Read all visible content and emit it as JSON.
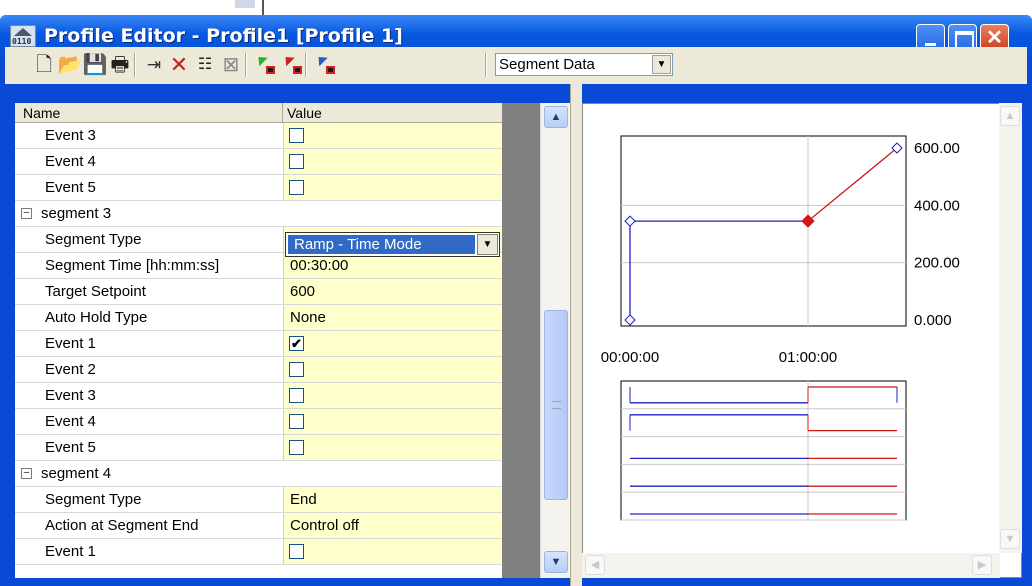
{
  "window": {
    "title": "Profile Editor - Profile1 [Profile 1]",
    "icon_text": "0110",
    "close_glyph": "✕"
  },
  "toolbar": {
    "icons": [
      "new-document-icon",
      "open-folder-icon",
      "save-icon",
      "print-icon",
      "insert-segment-icon",
      "delete-icon",
      "tree-icon",
      "clear-icon",
      "segment-icon-1",
      "segment-icon-2",
      "segment-info-icon"
    ],
    "view_selector": {
      "value": "Segment Data"
    }
  },
  "grid": {
    "columns": {
      "name": "Name",
      "value": "Value"
    },
    "rows": [
      {
        "name": "Event 3",
        "type": "check",
        "checked": false
      },
      {
        "name": "Event 4",
        "type": "check",
        "checked": false
      },
      {
        "name": "Event 5",
        "type": "check",
        "checked": false
      },
      {
        "name": "segment 3",
        "type": "group"
      },
      {
        "name": "Segment Type",
        "type": "dropdown",
        "value": "Ramp - Time Mode"
      },
      {
        "name": "Segment Time [hh:mm:ss]",
        "type": "text",
        "value": "00:30:00"
      },
      {
        "name": "Target Setpoint",
        "type": "text",
        "value": "600"
      },
      {
        "name": "Auto Hold Type",
        "type": "text",
        "value": "None"
      },
      {
        "name": "Event 1",
        "type": "check",
        "checked": true
      },
      {
        "name": "Event 2",
        "type": "check",
        "checked": false
      },
      {
        "name": "Event 3",
        "type": "check",
        "checked": false
      },
      {
        "name": "Event 4",
        "type": "check",
        "checked": false
      },
      {
        "name": "Event 5",
        "type": "check",
        "checked": false
      },
      {
        "name": "segment 4",
        "type": "group"
      },
      {
        "name": "Segment Type",
        "type": "text",
        "value": "End"
      },
      {
        "name": "Action at Segment End",
        "type": "text",
        "value": "Control off"
      },
      {
        "name": "Event 1",
        "type": "check",
        "checked": false
      }
    ]
  },
  "chart_data": {
    "type": "line",
    "x_tick_labels": [
      "00:00:00",
      "01:00:00"
    ],
    "y_tick_labels": [
      "600.00",
      "400.00",
      "200.00",
      "0.000"
    ],
    "ylim": [
      0,
      600
    ],
    "xlim_minutes": [
      0,
      90
    ],
    "series": [
      {
        "values": [
          [
            0,
            0
          ],
          [
            0,
            345
          ],
          [
            60,
            345
          ]
        ],
        "color": "#2020c0"
      },
      {
        "values": [
          [
            60,
            345
          ],
          [
            90,
            600
          ]
        ],
        "color": "#d01818"
      }
    ],
    "selected_point": [
      60,
      345
    ],
    "event_tracks": [
      {
        "track": 1,
        "segments": [
          {
            "from": 0,
            "to": 60,
            "level": "low",
            "color": "#2020c0"
          },
          {
            "from": 60,
            "to": 90,
            "level": "high",
            "color": "#d01818"
          }
        ]
      },
      {
        "track": 2,
        "segments": [
          {
            "from": 0,
            "to": 60,
            "level": "high",
            "color": "#2020c0"
          },
          {
            "from": 60,
            "to": 90,
            "level": "low",
            "color": "#d01818"
          }
        ]
      },
      {
        "track": 3,
        "segments": [
          {
            "from": 0,
            "to": 60,
            "level": "low",
            "color": "#2020c0"
          },
          {
            "from": 60,
            "to": 90,
            "level": "low",
            "color": "#d01818"
          }
        ]
      },
      {
        "track": 4,
        "segments": [
          {
            "from": 0,
            "to": 60,
            "level": "low",
            "color": "#2020c0"
          },
          {
            "from": 60,
            "to": 90,
            "level": "low",
            "color": "#d01818"
          }
        ]
      },
      {
        "track": 5,
        "segments": [
          {
            "from": 0,
            "to": 60,
            "level": "low",
            "color": "#2020c0"
          },
          {
            "from": 60,
            "to": 90,
            "level": "low",
            "color": "#d01818"
          }
        ]
      }
    ]
  },
  "colors": {
    "title_bar": "#0551d9",
    "value_cell": "#ffffcc",
    "selection": "#316ac5"
  }
}
